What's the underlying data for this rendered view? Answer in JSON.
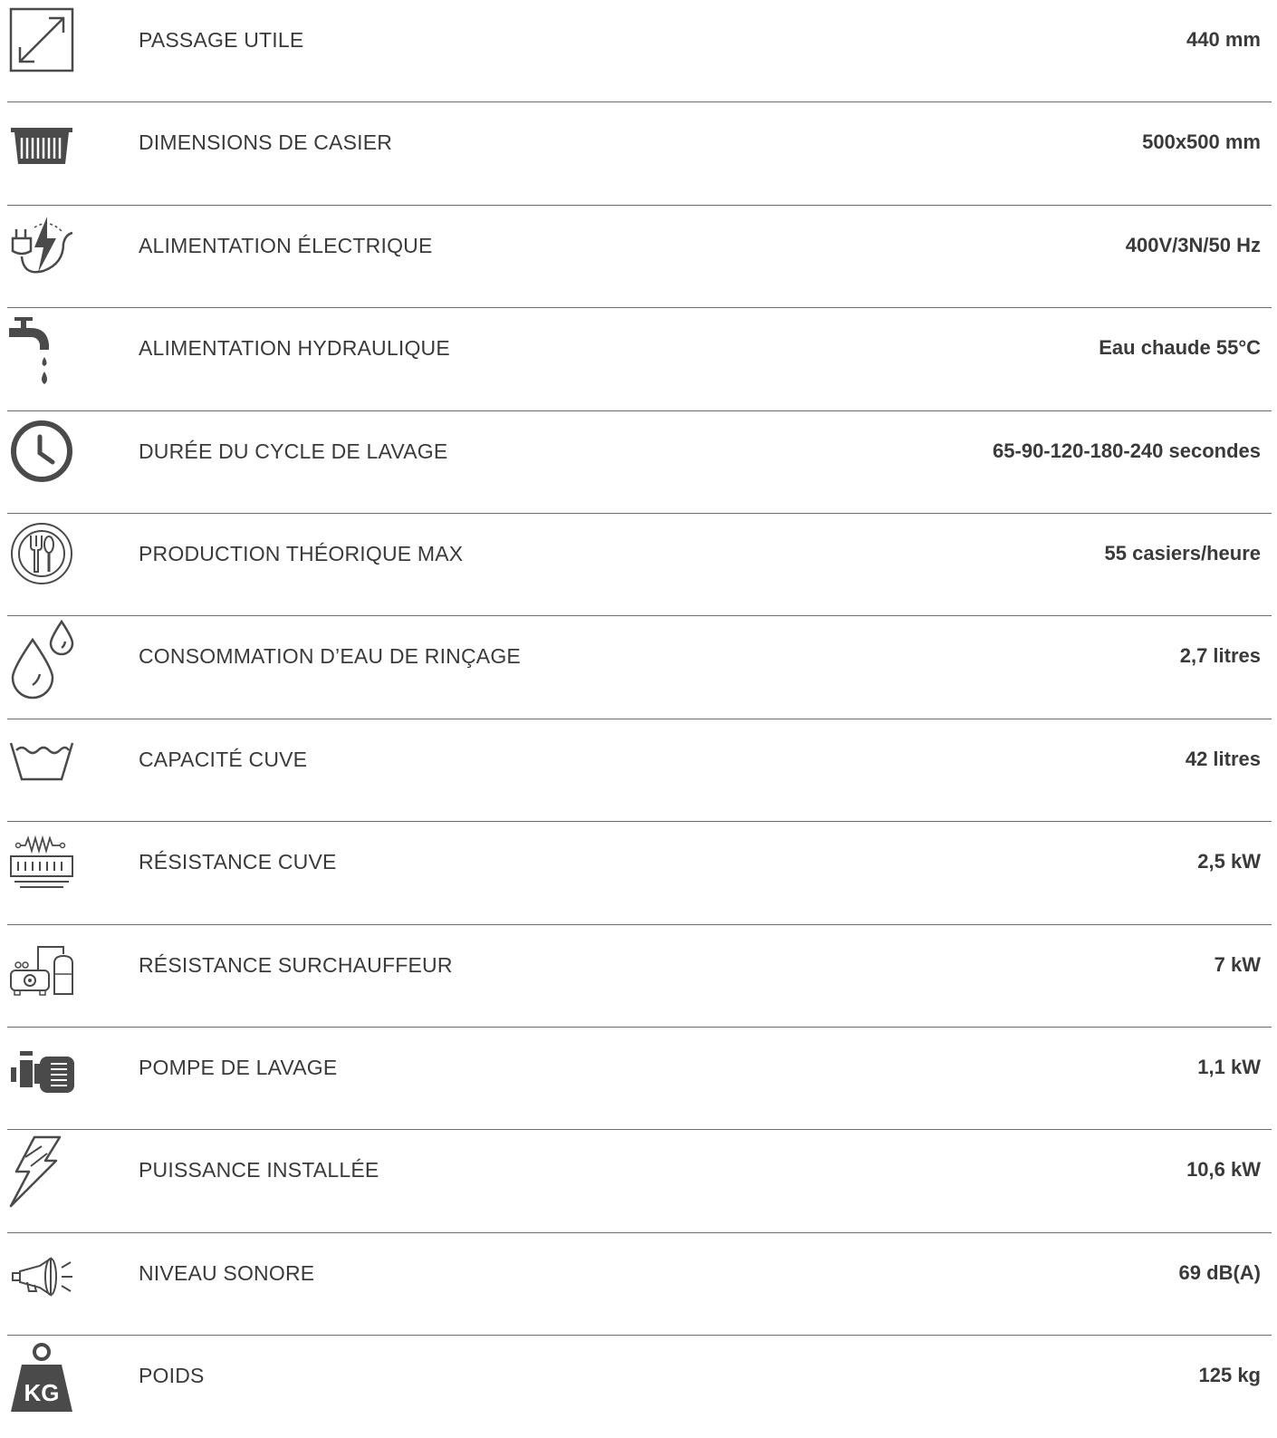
{
  "specs": [
    {
      "icon": "diagonal-arrow-icon",
      "label": "PASSAGE UTILE",
      "value": "440 mm"
    },
    {
      "icon": "rack-basket-icon",
      "label": "DIMENSIONS DE CASIER",
      "value": "500x500 mm"
    },
    {
      "icon": "electric-plug-icon",
      "label": "ALIMENTATION ÉLECTRIQUE",
      "value": "400V/3N/50 Hz"
    },
    {
      "icon": "water-tap-icon",
      "label": "ALIMENTATION HYDRAULIQUE",
      "value": "Eau chaude 55°C"
    },
    {
      "icon": "clock-icon",
      "label": "DURÉE DU CYCLE DE LAVAGE",
      "value": "65-90-120-180-240 secondes"
    },
    {
      "icon": "plate-cutlery-icon",
      "label": "PRODUCTION THÉORIQUE MAX",
      "value": "55 casiers/heure"
    },
    {
      "icon": "water-drops-icon",
      "label": "CONSOMMATION D’EAU DE RINÇAGE",
      "value": "2,7 litres"
    },
    {
      "icon": "tank-icon",
      "label": "CAPACITÉ CUVE",
      "value": "42 litres"
    },
    {
      "icon": "heating-resistor-icon",
      "label": "RÉSISTANCE CUVE",
      "value": "2,5 kW"
    },
    {
      "icon": "boiler-icon",
      "label": "RÉSISTANCE SURCHAUFFEUR",
      "value": "7 kW"
    },
    {
      "icon": "pump-motor-icon",
      "label": "POMPE DE LAVAGE",
      "value": "1,1 kW"
    },
    {
      "icon": "lightning-icon",
      "label": "PUISSANCE INSTALLÉE",
      "value": "10,6 kW"
    },
    {
      "icon": "megaphone-icon",
      "label": "NIVEAU SONORE",
      "value": "69 dB(A)"
    },
    {
      "icon": "weight-kg-icon",
      "label": "POIDS",
      "value": "125 kg",
      "icon_text": "KG"
    }
  ]
}
